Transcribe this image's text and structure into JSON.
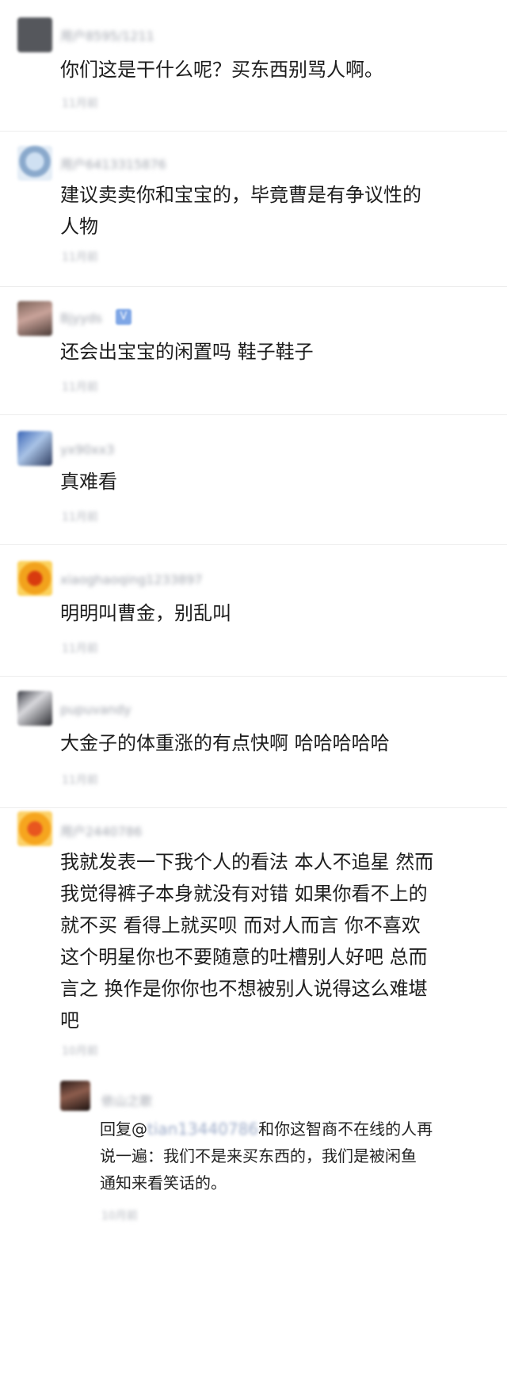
{
  "comments": [
    {
      "username": "用户8595/1211",
      "text": "你们这是干什么呢？买东西别骂人啊。",
      "time": "11月前"
    },
    {
      "username": "用户6413315876",
      "text": "建议卖卖你和宝宝的，毕竟曹是有争议性的\n人物",
      "time": "11月前"
    },
    {
      "username": "Bjyyds",
      "badge": "V",
      "text": "还会出宝宝的闲置吗 鞋子鞋子",
      "time": "11月前"
    },
    {
      "username": "yx90xx3",
      "text": "真难看",
      "time": "11月前"
    },
    {
      "username": "xiaoghaoqing1233897",
      "text": "明明叫曹金，别乱叫",
      "time": "11月前"
    },
    {
      "username": "pupuvandy",
      "text": "大金子的体重涨的有点快啊 哈哈哈哈哈",
      "time": "11月前"
    },
    {
      "username": "用户2440786",
      "text": "我就发表一下我个人的看法 本人不追星 然而\n我觉得裤子本身就没有对错 如果你看不上的\n就不买 看得上就买呗 而对人而言 你不喜欢\n这个明星你也不要随意的吐槽别人好吧 总而\n言之 换作是你你也不想被别人说得这么难堪\n吧",
      "time": "10月前"
    }
  ],
  "reply": {
    "username": "依山之歌",
    "prefix": "回复@",
    "mention": "tian13440786",
    "text_line1": "和你这智商不在线的人再",
    "text_rest": "说一遍：我们不是来买东西的，我们是被闲鱼\n通知来看笑话的。",
    "time": "10月前"
  }
}
